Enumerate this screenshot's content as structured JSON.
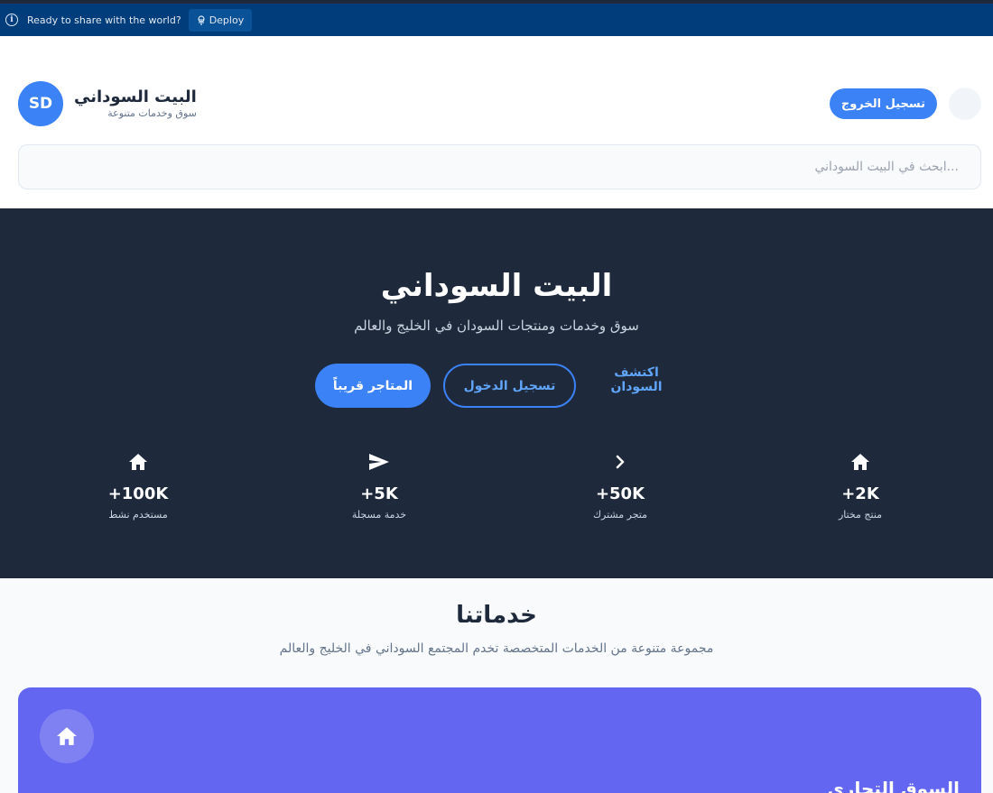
{
  "banner": {
    "message": "Ready to share with the world?",
    "deploy_label": "Deploy"
  },
  "header": {
    "logo_text": "SD",
    "brand_title": "البيت السوداني",
    "brand_subtitle": "سوق وخدمات متنوعة",
    "logout_label": "تسجيل الخروج",
    "search_placeholder": "...ابحث في البيت السوداني"
  },
  "hero": {
    "title": "البيت السوداني",
    "subtitle": "سوق وخدمات ومنتجات السودان في الخليج والعالم",
    "stores_button": "المتاجر قريباً",
    "login_button": "تسجيل الدخول",
    "explore_link": "اكتشف السودان",
    "stats": [
      {
        "value": "+100K",
        "label": "مستخدم نشط",
        "icon": "home-icon"
      },
      {
        "value": "+5K",
        "label": "خدمة مسجلة",
        "icon": "send-icon"
      },
      {
        "value": "+50K",
        "label": "متجر مشترك",
        "icon": "chevron-right-icon"
      },
      {
        "value": "+2K",
        "label": "منتج مختار",
        "icon": "home-icon"
      }
    ]
  },
  "services": {
    "title": "خدماتنا",
    "subtitle": "مجموعة متنوعة من الخدمات المتخصصة تخدم المجتمع السوداني في الخليج والعالم",
    "card_title": "السوق التجاري",
    "card_icon": "home-icon"
  },
  "colors": {
    "accent": "#3b82f6",
    "hero_bg": "#1e293b",
    "card_bg": "#6366f1",
    "banner_bg": "#003d7a"
  }
}
